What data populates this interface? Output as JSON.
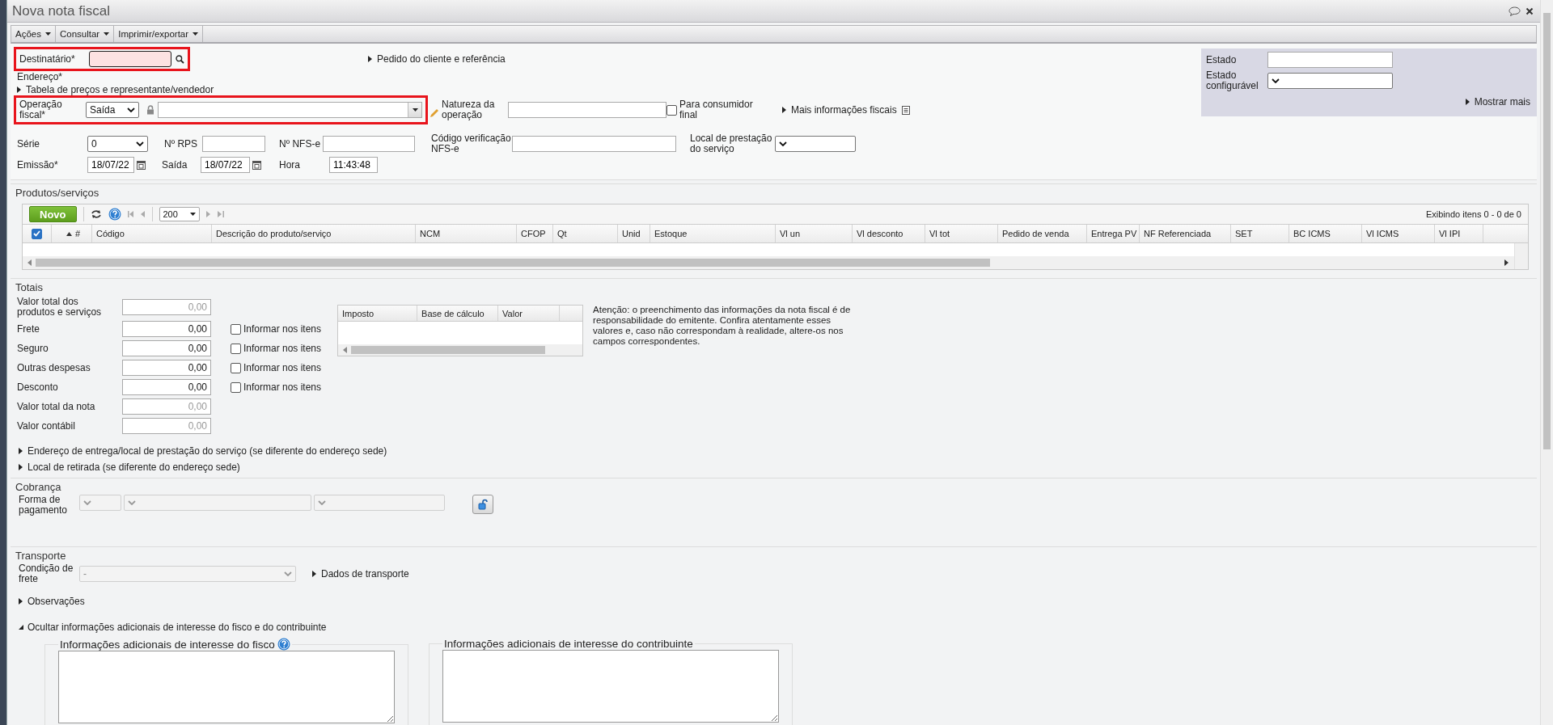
{
  "window": {
    "title": "Nova nota fiscal"
  },
  "menu": [
    {
      "label": "Ações"
    },
    {
      "label": "Consultar"
    },
    {
      "label": "Imprimir/exportar"
    }
  ],
  "recipient": {
    "label": "Destinatário*",
    "highlighted": true,
    "invalid": true
  },
  "order_link": {
    "label": "Pedido do cliente e referência",
    "expanded": false
  },
  "address_label": "Endereço*",
  "price_link": {
    "label": "Tabela de preços e representante/vendedor",
    "expanded": false
  },
  "operation": {
    "label": "Operação fiscal*",
    "highlighted": true,
    "type": "Saída"
  },
  "nature": {
    "label": "Natureza da operação"
  },
  "final_consumer": {
    "label": "Para consumidor final",
    "checked": false
  },
  "fiscal_link": {
    "label": "Mais informações fiscais",
    "expanded": false
  },
  "series": {
    "label": "Série",
    "value": "0"
  },
  "rps": {
    "label": "Nº RPS"
  },
  "nfse": {
    "label": "Nº NFS-e"
  },
  "verification": {
    "label": "Código verificação NFS-e"
  },
  "service_place": {
    "label": "Local de prestação do serviço"
  },
  "issue": {
    "label": "Emissão*",
    "value": "18/07/22"
  },
  "exit": {
    "label": "Saída",
    "value": "18/07/22"
  },
  "time": {
    "label": "Hora",
    "value": "11:43:48"
  },
  "status_panel": {
    "state_label": "Estado",
    "config_label": "Estado configurável",
    "more_link": {
      "label": "Mostrar mais",
      "expanded": false
    }
  },
  "products": {
    "title": "Produtos/serviços",
    "new_button": "Novo",
    "page_size": "200",
    "summary": "Exibindo itens 0 - 0 de 0",
    "select_all": {
      "checked": true
    },
    "columns": [
      {
        "label": "#",
        "sorted": true
      },
      {
        "label": "Código",
        "sorted": false
      },
      {
        "label": "Descrição do produto/serviço",
        "sorted": false
      },
      {
        "label": "NCM",
        "sorted": false
      },
      {
        "label": "CFOP",
        "sorted": false
      },
      {
        "label": "Qt",
        "sorted": false
      },
      {
        "label": "Unid",
        "sorted": false
      },
      {
        "label": "Estoque",
        "sorted": false
      },
      {
        "label": "Vl un",
        "sorted": false
      },
      {
        "label": "Vl desconto",
        "sorted": false
      },
      {
        "label": "Vl tot",
        "sorted": false
      },
      {
        "label": "Pedido de venda",
        "sorted": false
      },
      {
        "label": "Entrega PV",
        "sorted": false
      },
      {
        "label": "NF Referenciada",
        "sorted": false
      },
      {
        "label": "SET",
        "sorted": false
      },
      {
        "label": "BC ICMS",
        "sorted": false
      },
      {
        "label": "Vl ICMS",
        "sorted": false
      },
      {
        "label": "Vl IPI",
        "sorted": false
      }
    ]
  },
  "totals": {
    "title": "Totais",
    "rows": [
      {
        "label": "Valor total dos produtos e serviços",
        "value": "0,00",
        "kind": "calculated"
      },
      {
        "label": "Frete",
        "value": "0,00",
        "kind": "editable",
        "item_check": {
          "label": "Informar nos itens",
          "checked": false
        }
      },
      {
        "label": "Seguro",
        "value": "0,00",
        "kind": "editable",
        "item_check": {
          "label": "Informar nos itens",
          "checked": false
        }
      },
      {
        "label": "Outras despesas",
        "value": "0,00",
        "kind": "editable",
        "item_check": {
          "label": "Informar nos itens",
          "checked": false
        }
      },
      {
        "label": "Desconto",
        "value": "0,00",
        "kind": "editable",
        "item_check": {
          "label": "Informar nos itens",
          "checked": false
        }
      },
      {
        "label": "Valor total da nota",
        "value": "0,00",
        "kind": "calculated"
      },
      {
        "label": "Valor contábil",
        "value": "0,00",
        "kind": "calculated"
      }
    ],
    "tax_columns": [
      "Imposto",
      "Base de cálculo",
      "Valor"
    ],
    "notice": "Atenção: o preenchimento das informações da nota fiscal é de responsabilidade do emitente. Confira atentamente esses valores e, caso não correspondam à realidade, altere-os nos campos correspondentes."
  },
  "delivery_links": [
    {
      "label": "Endereço de entrega/local de prestação do serviço (se diferente do endereço sede)",
      "expanded": false
    },
    {
      "label": "Local de retirada (se diferente do endereço sede)",
      "expanded": false
    }
  ],
  "billing": {
    "title": "Cobrança",
    "payment_label": "Forma de pagamento"
  },
  "transport": {
    "title": "Transporte",
    "freight_label": "Condição de frete",
    "freight_value": "-",
    "freight_disabled": true,
    "data_link": {
      "label": "Dados de transporte",
      "expanded": false
    }
  },
  "observations_link": {
    "label": "Observações",
    "expanded": false
  },
  "additional_link": {
    "label": "Ocultar informações adicionais de interesse do fisco e do contribuinte",
    "expanded": true
  },
  "additional_boxes": [
    {
      "title": "Informações adicionais de interesse do fisco",
      "help": true
    },
    {
      "title": "Informações adicionais de interesse do contribuinte",
      "help": false
    }
  ]
}
